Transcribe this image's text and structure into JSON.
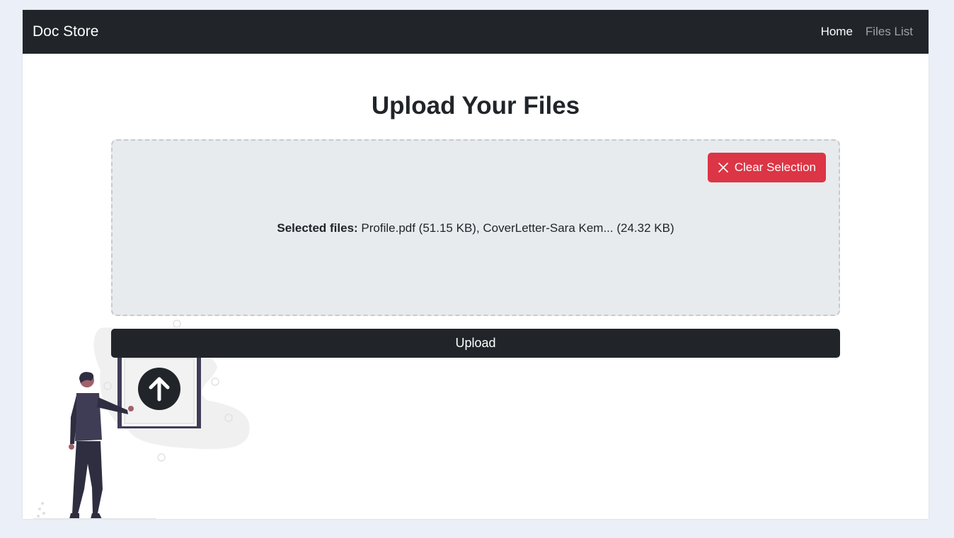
{
  "navbar": {
    "brand": "Doc Store",
    "links": [
      {
        "label": "Home",
        "active": true
      },
      {
        "label": "Files List",
        "active": false
      }
    ]
  },
  "main": {
    "title": "Upload Your Files",
    "dropzone": {
      "clear_label": "Clear Selection",
      "selected_label": "Selected files:",
      "selected_value": "Profile.pdf (51.15 KB), CoverLetter-Sara Kem... (24.32 KB)"
    },
    "upload_label": "Upload"
  },
  "colors": {
    "navbar_bg": "#212529",
    "danger": "#dc3545",
    "page_bg": "#ebeff7",
    "dropzone_bg": "#e8ebee"
  },
  "icons": {
    "clear": "close-icon",
    "upload": "arrow-up-circle-icon"
  }
}
